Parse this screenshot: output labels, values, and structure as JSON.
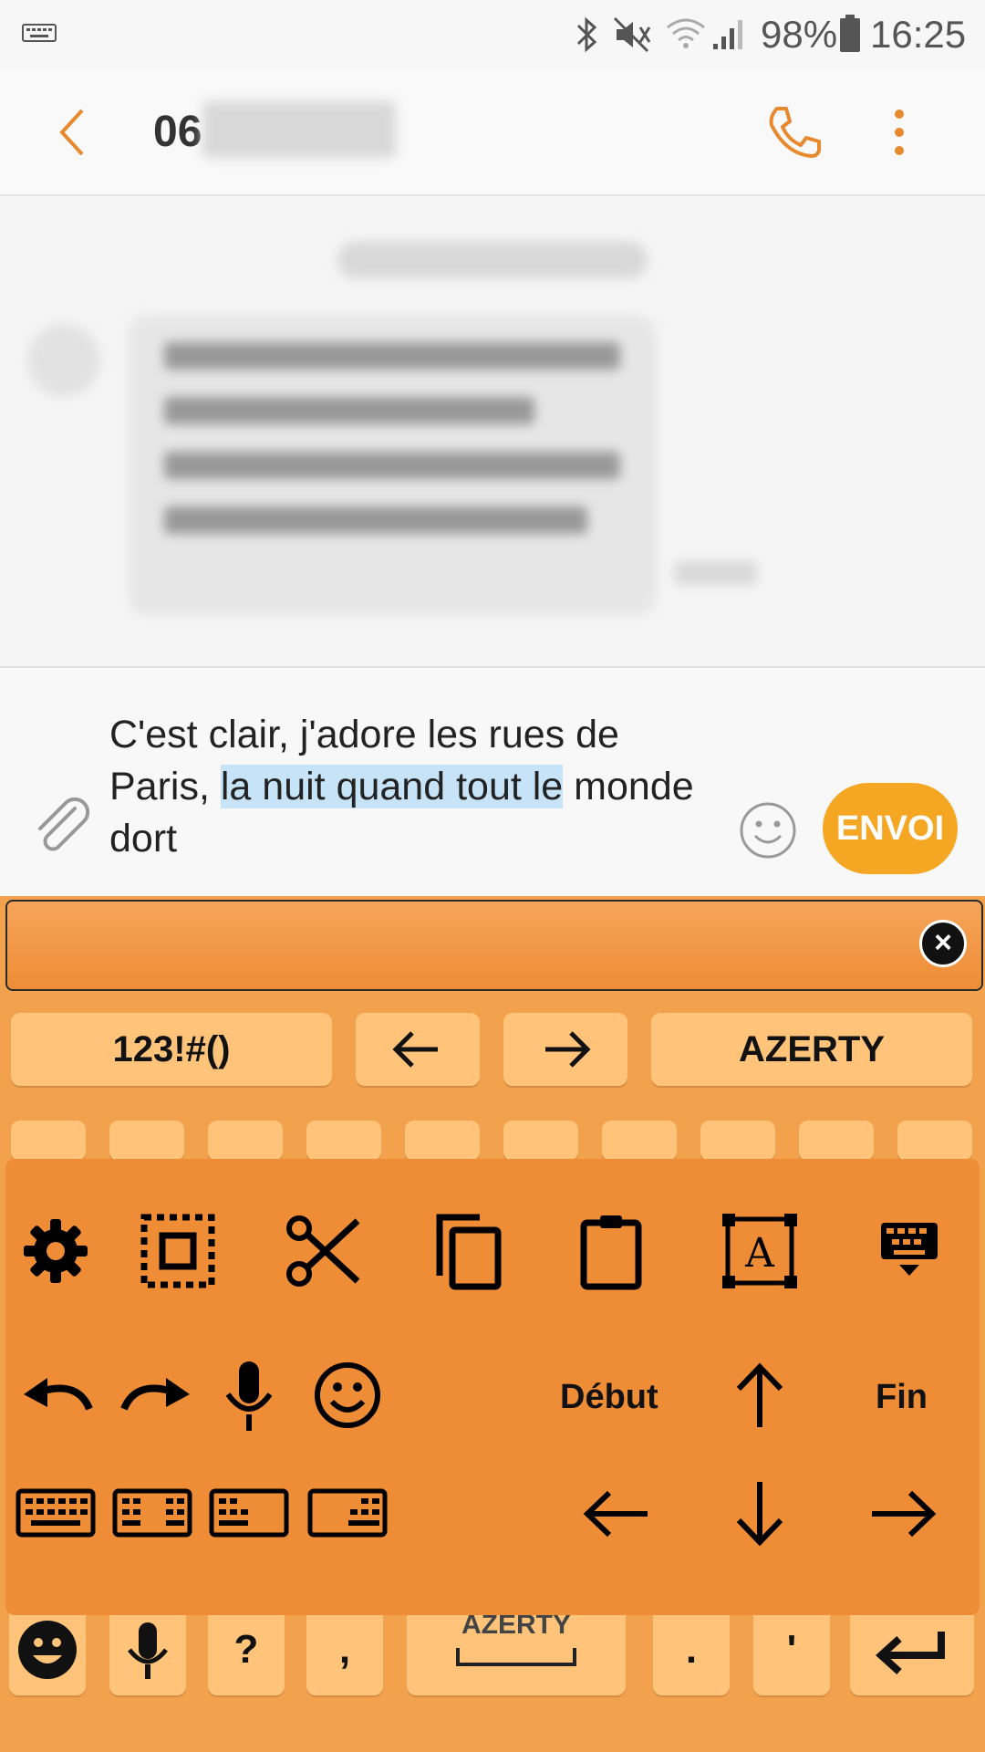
{
  "status": {
    "battery": "98%",
    "time": "16:25"
  },
  "header": {
    "contact_prefix": "06"
  },
  "composer": {
    "message_plain": "C'est clair,  j'adore les rues de Paris, ",
    "message_selected": "la nuit quand tout le",
    "message_after": " monde dort",
    "send_label": "ENVOI"
  },
  "keyboard": {
    "toolbar": {
      "numbers_label": "123!#()",
      "layout_label": "AZERTY"
    },
    "panel": {
      "home_label": "Début",
      "end_label": "Fin"
    },
    "bottom": {
      "question": "?",
      "comma": ",",
      "space_label": "AZERTY",
      "period": ".",
      "apostrophe": "'"
    }
  },
  "colors": {
    "accent": "#f5a623",
    "keyboard_bg": "#f2a14c",
    "key": "#ffc47a",
    "selection": "#c6e3f7"
  }
}
